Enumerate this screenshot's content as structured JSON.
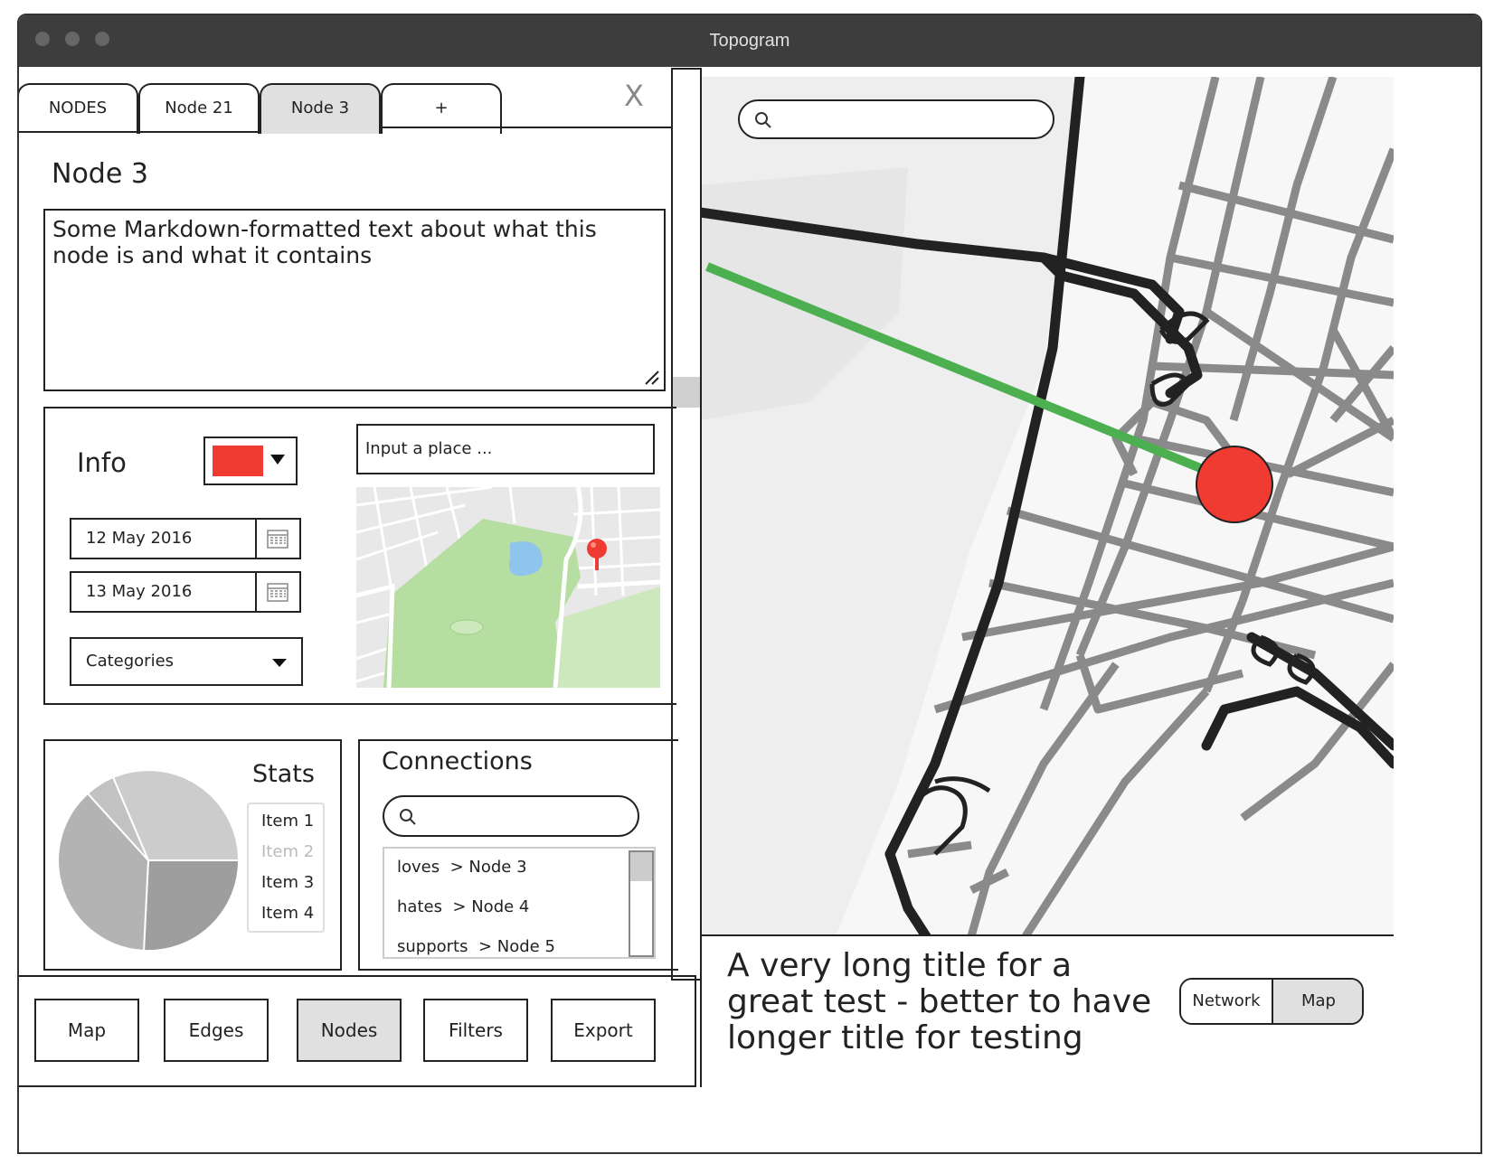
{
  "window": {
    "title": "Topogram"
  },
  "tabs": [
    {
      "label": "NODES",
      "active": false
    },
    {
      "label": "Node 21",
      "active": false
    },
    {
      "label": "Node 3",
      "active": true
    },
    {
      "label": "+",
      "active": false
    }
  ],
  "close_label": "X",
  "node": {
    "title": "Node 3",
    "description": "Some Markdown-formatted text about what this node is and what it contains"
  },
  "info": {
    "heading": "Info",
    "color": "#ef3b32",
    "place_placeholder": "Input a place ...",
    "start_date": "12 May 2016",
    "end_date": "13 May 2016",
    "categories_label": "Categories"
  },
  "stats": {
    "heading": "Stats",
    "items": [
      {
        "label": "Item 1",
        "enabled": true
      },
      {
        "label": "Item 2",
        "enabled": false
      },
      {
        "label": "Item 3",
        "enabled": true
      },
      {
        "label": "Item 4",
        "enabled": true
      }
    ]
  },
  "connections": {
    "heading": "Connections",
    "search_placeholder": "",
    "items": [
      {
        "relation": "loves",
        "target": "> Node 3"
      },
      {
        "relation": "hates",
        "target": "> Node 4"
      },
      {
        "relation": "supports",
        "target": "> Node 5"
      }
    ]
  },
  "bottom_nav": [
    {
      "label": "Map",
      "active": false
    },
    {
      "label": "Edges",
      "active": false
    },
    {
      "label": "Nodes",
      "active": true
    },
    {
      "label": "Filters",
      "active": false
    },
    {
      "label": "Export",
      "active": false
    }
  ],
  "map": {
    "search_placeholder": "",
    "edge_color": "#4caf50",
    "node_color": "#ef3b32"
  },
  "footer": {
    "title": "A very long title for a great test - better to have longer title for testing",
    "toggle": [
      {
        "label": "Network",
        "active": false
      },
      {
        "label": "Map",
        "active": true
      }
    ]
  }
}
